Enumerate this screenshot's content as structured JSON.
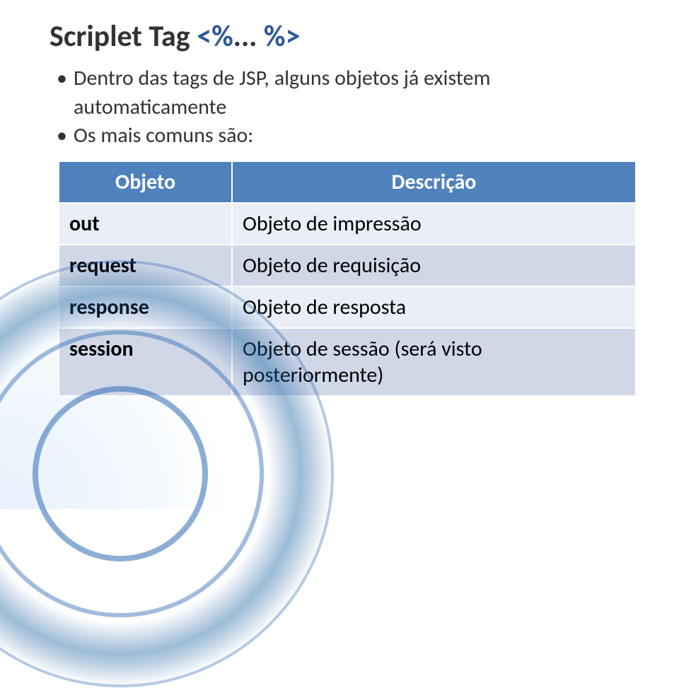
{
  "title_plain": "Scriplet Tag ",
  "title_tag_open": "<%",
  "title_tag_dots": "... ",
  "title_tag_close": "%>",
  "bullets": [
    "Dentro das tags de JSP, alguns objetos já existem automaticamente",
    "Os mais comuns são:"
  ],
  "table": {
    "headers": [
      "Objeto",
      "Descrição"
    ],
    "rows": [
      {
        "obj": "out",
        "desc": "Objeto de impressão"
      },
      {
        "obj": "request",
        "desc": "Objeto de requisição"
      },
      {
        "obj": "response",
        "desc": "Objeto de resposta"
      },
      {
        "obj": "session",
        "desc": "Objeto de sessão (será visto posteriormente)"
      }
    ]
  }
}
